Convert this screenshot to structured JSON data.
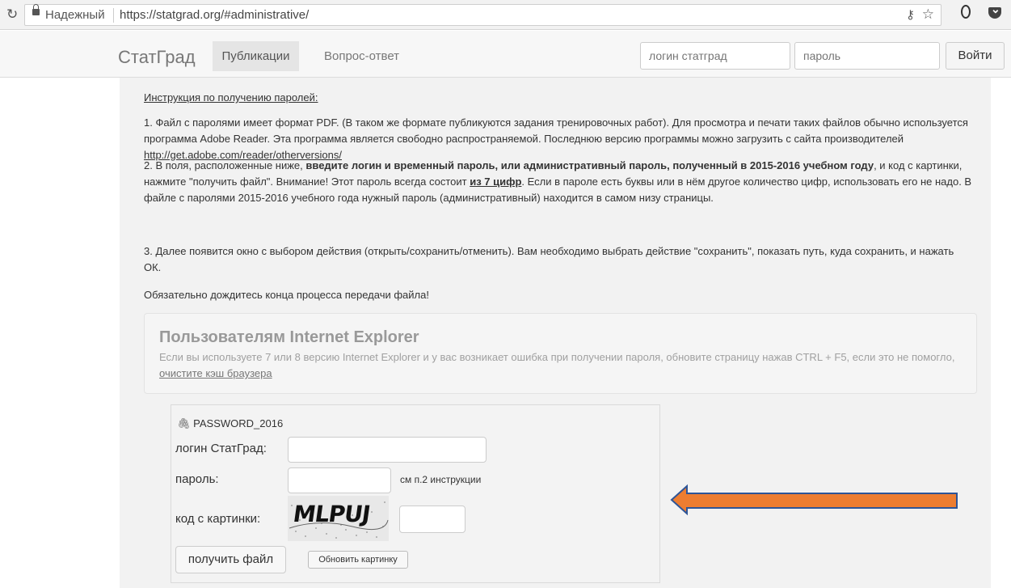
{
  "browser": {
    "secure_label": "Надежный",
    "url": "https://statgrad.org/#administrative/"
  },
  "nav": {
    "brand": "СтатГрад",
    "tabs": [
      "Публикации",
      "Вопрос-ответ"
    ],
    "login_placeholder": "логин статград",
    "password_placeholder": "пароль",
    "login_button": "Войти"
  },
  "instructions": {
    "heading": "Инструкция по получению паролей:",
    "p1_text": "1. Файл с паролями имеет формат PDF. (В таком же формате публикуются задания тренировочных работ). Для просмотра и печати таких файлов обычно используется программа Adobe Reader. Эта программа является свободно распространяемой. Последнюю версию программы можно загрузить с сайта производителей ",
    "p1_link": "http://get.adobe.com/reader/otherversions/",
    "p2_start": "2.  В поля, расположенные ниже, ",
    "p2_bold": "введите логин и временный пароль, или административный пароль, полученный в 2015-2016 учебном году",
    "p2_mid": ", и код с картинки, нажмите \"получить файл\". Внимание! Этот пароль всегда состоит ",
    "p2_bold2": "из 7 цифр",
    "p2_end": ". Если в пароле есть буквы или в нём другое количество цифр, использовать его не надо. В файле с паролями 2015-2016 учебного года нужный пароль (административный) находится в самом низу страницы.",
    "p3": "3. Далее появится окно с выбором действия (открыть/сохранить/отменить). Вам необходимо выбрать действие \"сохранить\", показать путь, куда сохранить, и нажать ОК.",
    "p4": "Обязательно дождитесь конца процесса передачи файла!"
  },
  "ie_notice": {
    "title": "Пользователям Internet Explorer",
    "text": "Если вы используете 7 или 8 версию Internet Explorer и у вас возникает ошибка при получении пароля, обновите страницу нажав CTRL + F5, если это не помогло, ",
    "link": "очистите кэш браузера"
  },
  "form": {
    "title": "PASSWORD_2016",
    "login_label": "логин СтатГрад:",
    "password_label": "пароль:",
    "password_hint": "см п.2 инструкции",
    "captcha_label": "код с картинки:",
    "captcha_text": "MLPUJ",
    "get_button": "получить файл",
    "refresh_button": "Обновить картинку"
  },
  "colors": {
    "arrow_fill": "#ED7D31",
    "arrow_stroke": "#2E5597"
  },
  "icons": [
    "reload-icon",
    "lock-icon",
    "key-icon",
    "star-icon",
    "opera-icon",
    "pocket-icon",
    "paperclip-icon"
  ]
}
